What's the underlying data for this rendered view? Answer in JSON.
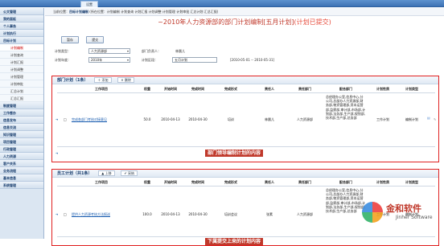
{
  "topbar": {
    "tab_label": "设置"
  },
  "sidebar": {
    "items": [
      {
        "label": "公文管理",
        "type": "head"
      },
      {
        "label": "我的面板",
        "type": "head"
      },
      {
        "label": "个人事务",
        "type": "head"
      },
      {
        "label": "计划执行",
        "type": "head"
      },
      {
        "label": "目标计划",
        "type": "head"
      },
      {
        "label": "计划编制",
        "type": "sub"
      },
      {
        "label": "计划查询",
        "type": "sub"
      },
      {
        "label": "计划汇报",
        "type": "sub"
      },
      {
        "label": "计划调整",
        "type": "sub"
      },
      {
        "label": "计划管理",
        "type": "sub"
      },
      {
        "label": "计划审批",
        "type": "sub"
      },
      {
        "label": "汇总计划",
        "type": "sub"
      },
      {
        "label": "汇总汇报",
        "type": "sub"
      },
      {
        "label": "制度管理",
        "type": "head"
      },
      {
        "label": "工作督办",
        "type": "head"
      },
      {
        "label": "信息发布",
        "type": "head"
      },
      {
        "label": "信息交流",
        "type": "head"
      },
      {
        "label": "知识管理",
        "type": "head"
      },
      {
        "label": "项目管理",
        "type": "head"
      },
      {
        "label": "行政管理",
        "type": "head"
      },
      {
        "label": "人力资源",
        "type": "head"
      },
      {
        "label": "客户关系",
        "type": "head"
      },
      {
        "label": "业务流程",
        "type": "head"
      },
      {
        "label": "基本信息",
        "type": "head"
      },
      {
        "label": "系统管理",
        "type": "head"
      }
    ]
  },
  "breadcrumb": {
    "prefix": "当前位置：",
    "current": "目标计划编制",
    "rest": "(所在位置：计划编制 计划查询 计划汇报 计划调整 计划管理 计划审批 汇总计划 汇总汇报)"
  },
  "page_title": {
    "main": "~2010年人力资源部的部门计划编制[五月计划]",
    "status": "(计划已提交)"
  },
  "buttons": {
    "save": "暂存",
    "submit": "提交"
  },
  "form": {
    "plan_type_label": "计划类型：",
    "plan_type_value": "人力资源部",
    "dept_head_label": "部门负责人：",
    "dept_head_value": "林晨儿",
    "plan_year_label": "计划年度：",
    "plan_year_value": "2010年",
    "plan_period_label": "计划区段：",
    "plan_period_value": "五月计划",
    "date_range": "[2010-05-01 -- 2010-05-31]"
  },
  "dept_section": {
    "title": "部门计划（1条）",
    "add": "添加",
    "delete": "删除",
    "headers": [
      "工作项目",
      "权重",
      "开始时间",
      "完成时间",
      "完成形式",
      "责任人",
      "责任部门",
      "配合部门",
      "计划性质",
      "计划类型"
    ],
    "row": {
      "project": "完成各部门考核对接意见",
      "weight": "50.0",
      "start": "2010-04-13",
      "end": "2010-04-30",
      "form": "培训",
      "owner": "林晨儿",
      "dept": "人力资源部",
      "coop": "总经理办公室,信息中心,分公司,总部办人力资源部,财务部,物资管理部,资本运营部,监察部,审计部,市场部,计划部,法务部,生产部,规划部,技术部,生产部,总务部",
      "nature": "工作计划",
      "ptype": "编制计划"
    },
    "watermark": "部门领导编制计划的内容"
  },
  "staff_section": {
    "title": "员工计划（共1条）",
    "up": "上移",
    "confirm": "采纳",
    "headers": [
      "工作项目",
      "权重",
      "开始时间",
      "完成时间",
      "完成形式",
      "责任人",
      "责任部门",
      "配合部门",
      "计划性质",
      "计划类型"
    ],
    "row": {
      "project": "提供人力资源考核方法报送",
      "weight": "100.0",
      "start": "2010-04-13",
      "end": "2010-04-30",
      "form": "培训会议",
      "owner": "张素",
      "dept": "人力资源部",
      "coop": "总经理办公室,信息中心,分公司,总部办人力资源部,财务部,物资管理部,资本运营部,监察部,审计部,市场部,计划部,法务部,生产部,规划部,技术部,生产部,总务部",
      "nature": "工作计划",
      "ptype": "编制计划"
    },
    "watermark": "下属提交上来的计划内容"
  },
  "logo": {
    "cn": "金和软件",
    "en": "Jinher Software"
  }
}
